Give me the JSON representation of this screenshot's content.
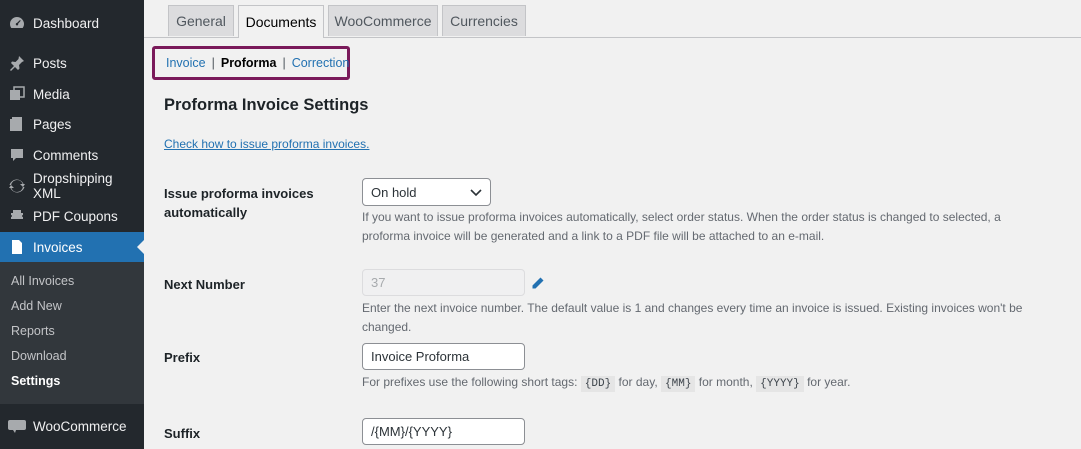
{
  "sidebar": {
    "items": [
      {
        "label": "Dashboard",
        "icon": "dashboard-icon"
      },
      {
        "label": "Posts",
        "icon": "pin-icon"
      },
      {
        "label": "Media",
        "icon": "media-icon"
      },
      {
        "label": "Pages",
        "icon": "pages-icon"
      },
      {
        "label": "Comments",
        "icon": "comments-icon"
      },
      {
        "label": "Dropshipping XML",
        "icon": "sync-icon"
      },
      {
        "label": "PDF Coupons",
        "icon": "coupon-icon"
      },
      {
        "label": "Invoices",
        "icon": "invoice-icon"
      },
      {
        "label": "WooCommerce",
        "icon": "woo-icon"
      }
    ],
    "submenu": [
      "All Invoices",
      "Add New",
      "Reports",
      "Download",
      "Settings"
    ]
  },
  "tabs": [
    "General",
    "Documents",
    "WooCommerce",
    "Currencies"
  ],
  "subnav": {
    "invoice": "Invoice",
    "sep": "|",
    "proforma": "Proforma",
    "correction": "Correction"
  },
  "page": {
    "title": "Proforma Invoice Settings",
    "help_link": "Check how to issue proforma invoices."
  },
  "fields": {
    "issue": {
      "label": "Issue proforma invoices automatically",
      "value": "On hold",
      "desc": "If you want to issue proforma invoices automatically, select order status. When the order status is changed to selected, a proforma invoice will be generated and a link to a PDF file will be attached to an e-mail."
    },
    "next_number": {
      "label": "Next Number",
      "value": "37",
      "desc": "Enter the next invoice number. The default value is 1 and changes every time an invoice is issued. Existing invoices won't be changed."
    },
    "prefix": {
      "label": "Prefix",
      "value": "Invoice Proforma",
      "desc_start": "For prefixes use the following short tags:",
      "tag_dd": "{DD}",
      "for_day": "for day,",
      "tag_mm": "{MM}",
      "for_month": "for month,",
      "tag_yyyy": "{YYYY}",
      "for_year": "for year."
    },
    "suffix": {
      "label": "Suffix",
      "value": "/{MM}/{YYYY}"
    }
  },
  "colors": {
    "sidebar_bg": "#23282d",
    "accent": "#2271b1",
    "highlight_border": "#7a1a5a"
  }
}
